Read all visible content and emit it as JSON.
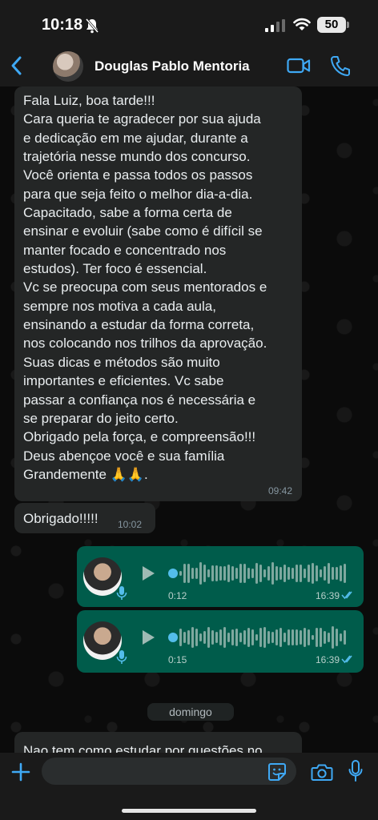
{
  "status_bar": {
    "time": "10:18",
    "battery": "50"
  },
  "header": {
    "contact_name": "Douglas Pablo Mentoria"
  },
  "messages": [
    {
      "text": "Fala Luiz, boa tarde!!!\nCara queria te agradecer por sua ajuda\ne dedicação em me ajudar, durante a\ntrajetória nesse mundo dos concurso.\nVocê orienta e passa todos os passos\npara que seja feito o melhor dia-a-dia.\nCapacitado, sabe a forma certa de\nensinar e evoluir (sabe como é difícil se\nmanter focado e concentrado nos\nestudos). Ter foco é essencial.\nVc se preocupa com seus mentorados e\nsempre nos motiva a cada aula,\nensinando a estudar da forma correta,\nnos colocando nos trilhos da aprovação.\nSuas dicas e métodos são muito\nimportantes e eficientes. Vc sabe\npassar a confiança nos é necessária e\nse preparar do jeito certo.\nObrigado pela força, e compreensão!!!\nDeus abençoe você e sua família\nGrandemente 🙏🙏.",
      "time": "09:42"
    },
    {
      "text": "Obrigado!!!!!",
      "time": "10:02"
    }
  ],
  "voice_notes": [
    {
      "duration": "0:12",
      "time": "16:39"
    },
    {
      "duration": "0:15",
      "time": "16:39"
    }
  ],
  "day_separator": "domingo",
  "last_message_partial": "Nao tem como estudar por questões no",
  "icons": {
    "back": "chevron-left-icon",
    "video": "video-camera-icon",
    "phone": "phone-icon",
    "plus": "plus-icon",
    "sticker": "sticker-icon",
    "camera": "camera-icon",
    "mic": "microphone-icon"
  },
  "colors": {
    "accent": "#3fa9f5",
    "outgoing_bubble": "#005c4b",
    "incoming_bubble": "#242626",
    "read_ticks": "#53bdeb"
  }
}
